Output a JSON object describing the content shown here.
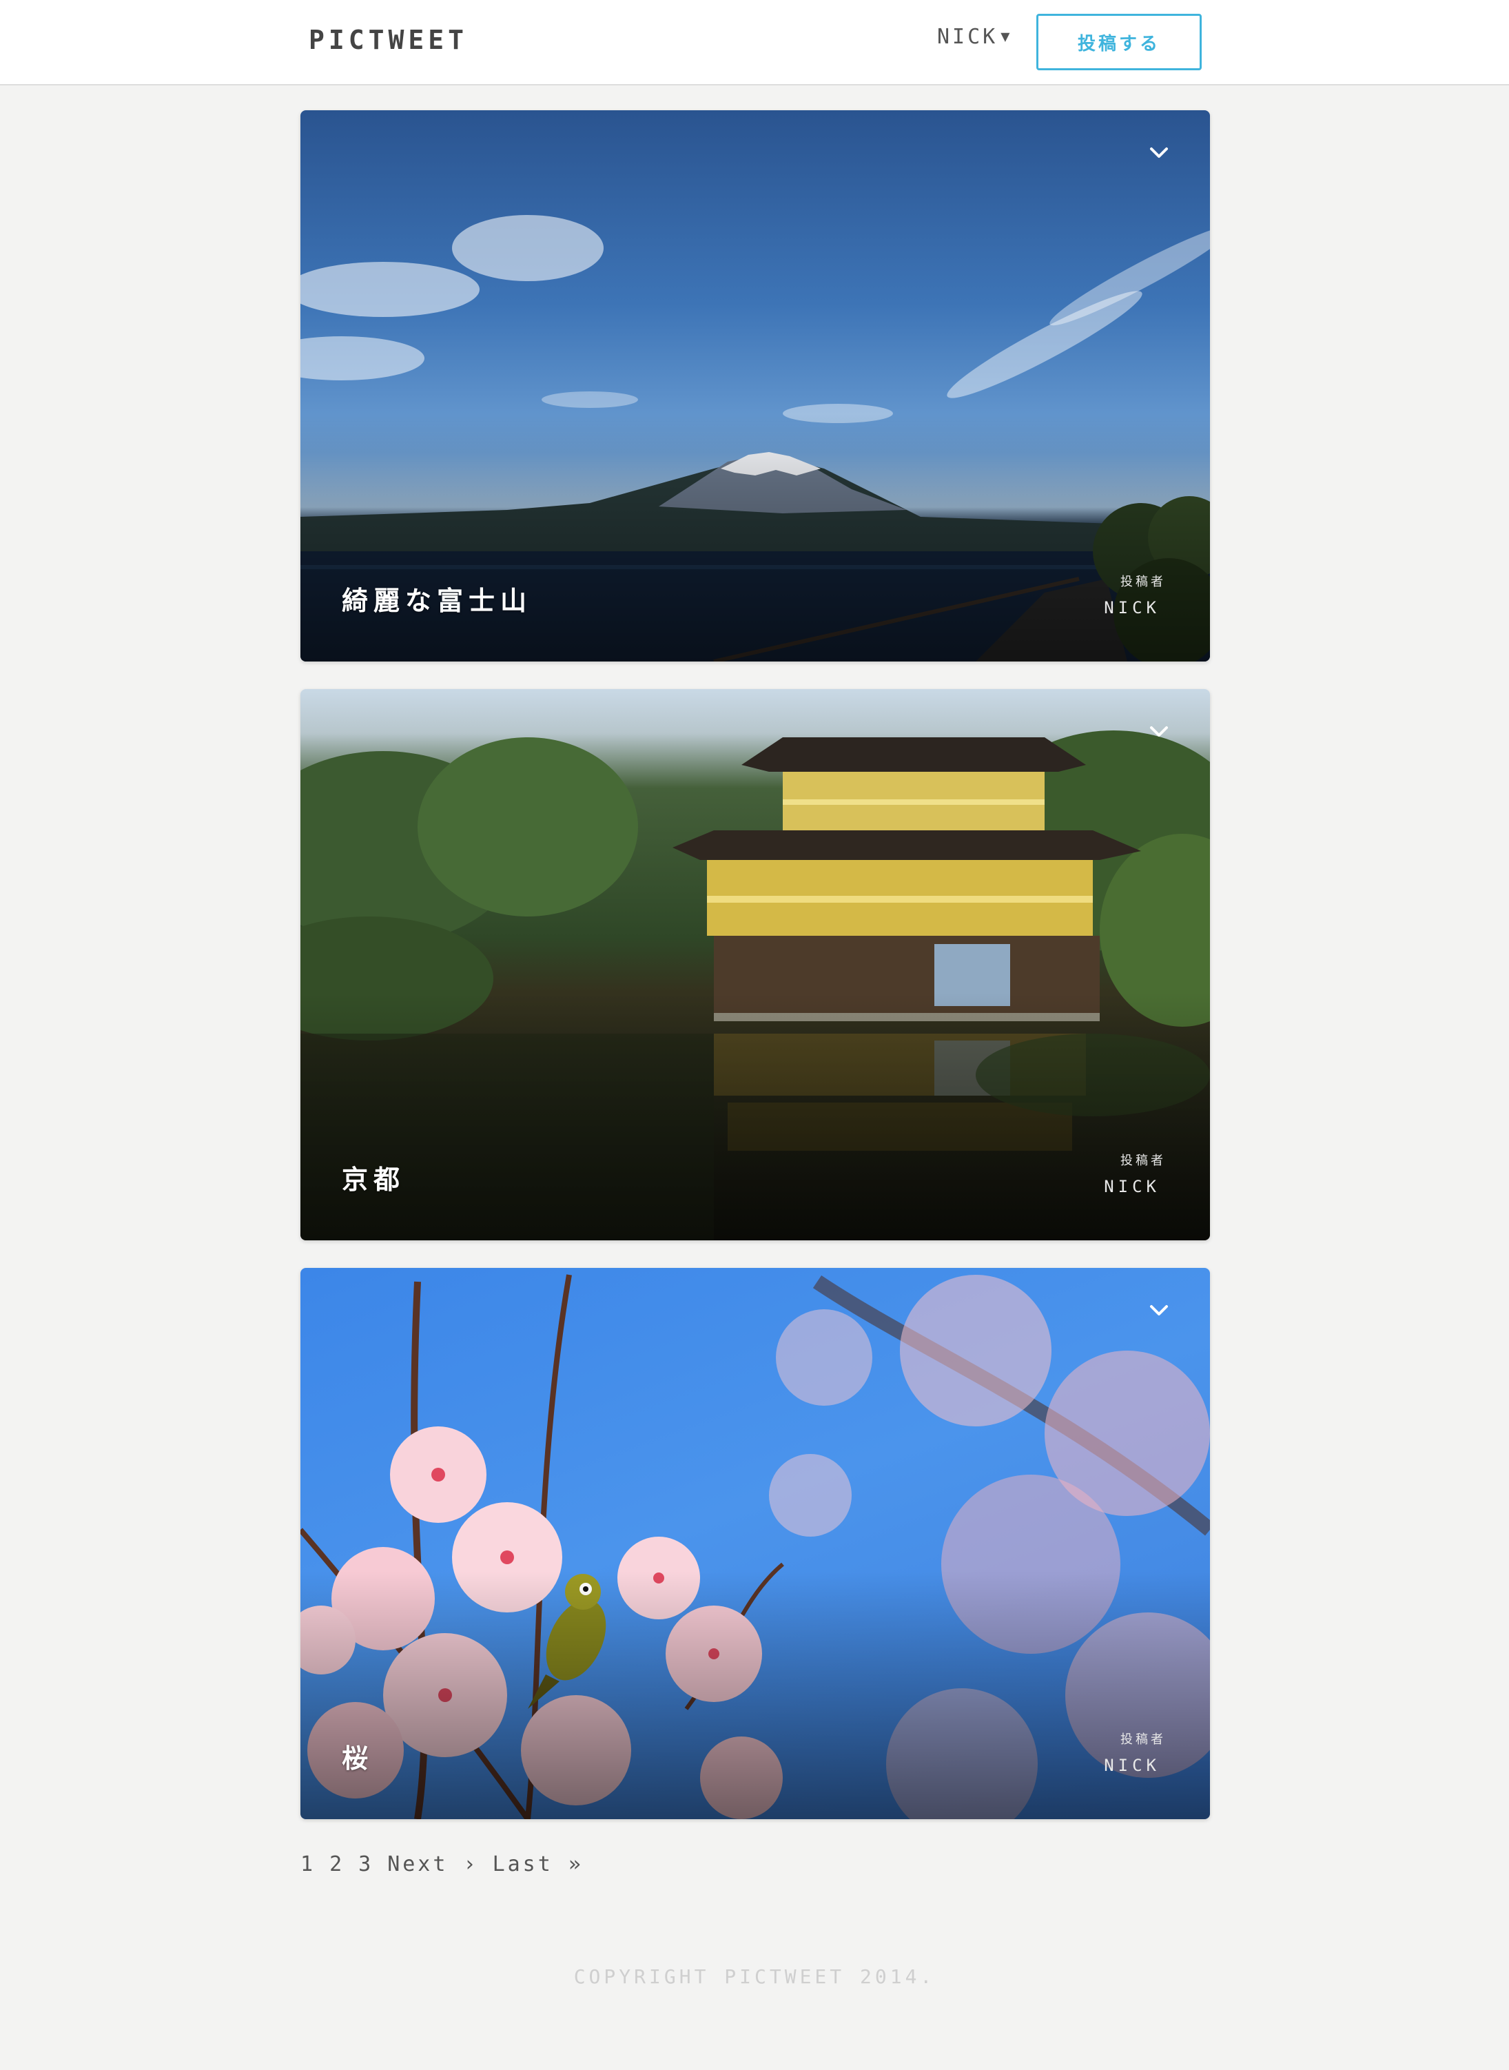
{
  "header": {
    "logo": "PICTWEET",
    "user_name": "NICK",
    "user_caret": "▼",
    "post_button_label": "投稿する"
  },
  "posts": [
    {
      "title": "綺麗な富士山",
      "by_label": "投稿者",
      "author": "NICK",
      "icon": "chevron-down-icon"
    },
    {
      "title": "京都",
      "by_label": "投稿者",
      "author": "NICK",
      "icon": "chevron-down-icon"
    },
    {
      "title": "桜",
      "by_label": "投稿者",
      "author": "NICK",
      "icon": "chevron-down-icon"
    }
  ],
  "pagination": {
    "pages": [
      "1",
      "2",
      "3"
    ],
    "next": "Next ›",
    "last": "Last »"
  },
  "footer": {
    "copyright": "COPYRIGHT PICTWEET 2014."
  },
  "colors": {
    "accent": "#3fb4dd",
    "background": "#f3f3f2"
  }
}
